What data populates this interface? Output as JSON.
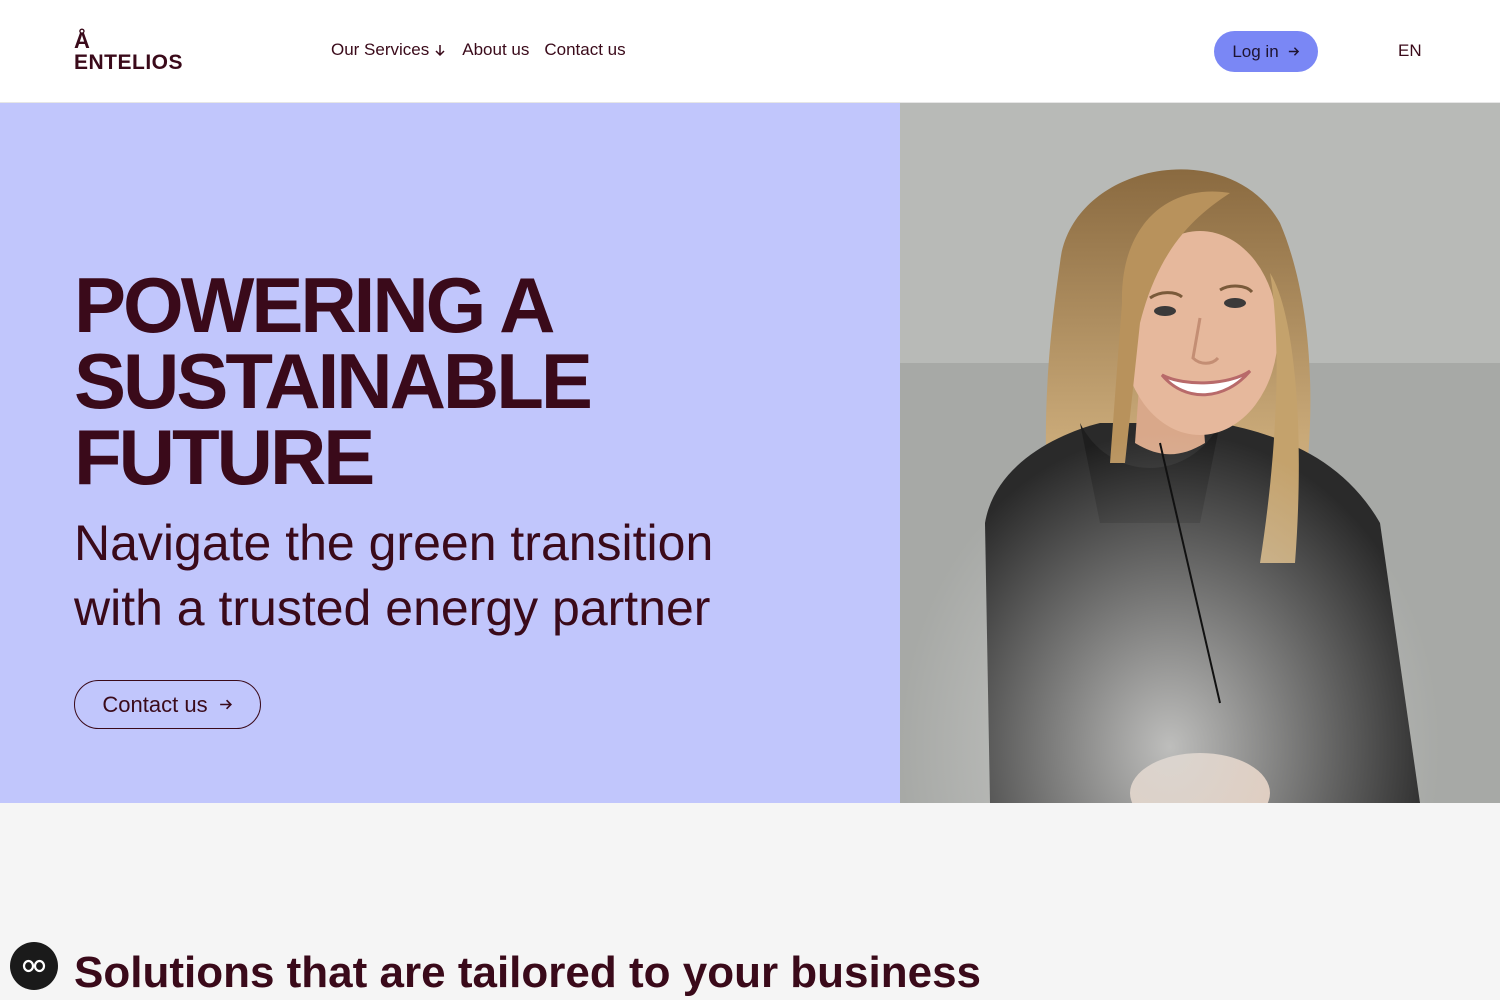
{
  "header": {
    "logo_mark": "Å",
    "logo_text": "ENTELIOS",
    "nav": [
      {
        "label": "Our Services",
        "icon": "arrow-down-icon"
      },
      {
        "label": "About us"
      },
      {
        "label": "Contact us"
      }
    ],
    "login_label": "Log in",
    "language": "EN"
  },
  "hero": {
    "title": "POWERING A\nSUSTAINABLE\nFUTURE",
    "subtitle": "Navigate the green transition\nwith a trusted energy partner",
    "cta_label": "Contact us"
  },
  "solutions": {
    "title": "Solutions that are tailored to your business"
  },
  "colors": {
    "brand_text": "#3a0a1a",
    "hero_bg": "#c1c6fc",
    "login_bg": "#7a87f5",
    "page_bg": "#f5f5f5"
  }
}
